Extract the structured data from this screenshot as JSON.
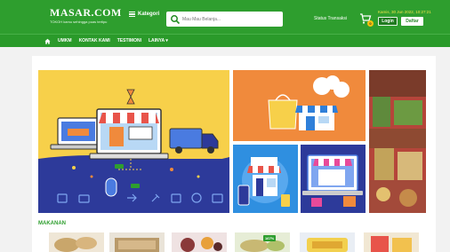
{
  "header": {
    "logo": "MASAR.COM",
    "tagline": "TOKOH kamu sehingga puas tertipu",
    "kategori_label": "Kategori",
    "search_placeholder": "Mau Mau Belanja...",
    "status_label": "Status Transaksi",
    "cart_count": "0",
    "datetime": "Kamis, 30 Jun 2022, 10:27:21",
    "login_label": "Login",
    "daftar_label": "Daftar"
  },
  "nav": {
    "items": [
      "UMKM",
      "KONTAK KAMI",
      "TESTIMONI",
      "LAINYA ▾"
    ]
  },
  "section": {
    "title": "MAKANAN"
  },
  "products": [
    {
      "badge": ""
    },
    {
      "badge": ""
    },
    {
      "badge": ""
    },
    {
      "badge": "167%"
    },
    {
      "badge": ""
    },
    {
      "badge": ""
    }
  ],
  "colors": {
    "brand_green": "#2e9e2e",
    "hero_yellow": "#f7d04a",
    "hero_navy": "#2d3a9a",
    "promo_orange": "#f08a3c",
    "promo_blue": "#2f7fd9"
  },
  "icons": {
    "menu": "hamburger-icon",
    "search": "search-icon",
    "cart": "cart-icon",
    "home": "home-icon"
  }
}
